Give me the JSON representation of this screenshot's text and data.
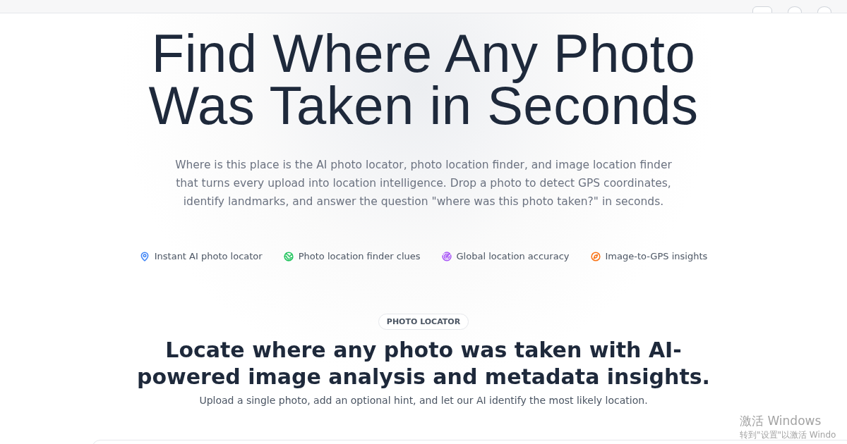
{
  "hero": {
    "title_lines": [
      "Find Where Any Photo",
      "Was Taken in Seconds"
    ],
    "description": "Where is this place is the AI photo locator, photo location finder, and image location finder that turns every upload into location intelligence. Drop a photo to detect GPS coordinates, identify landmarks, and answer the question \"where was this photo taken?\" in seconds.",
    "features": [
      {
        "kind": "pin",
        "label": "Instant AI photo locator",
        "color": "#3b82f6"
      },
      {
        "kind": "globe",
        "label": "Photo location finder clues",
        "color": "#22c55e"
      },
      {
        "kind": "radar",
        "label": "Global location accuracy",
        "color": "#a855f7"
      },
      {
        "kind": "compass",
        "label": "Image-to-GPS insights",
        "color": "#f97316"
      }
    ]
  },
  "locator": {
    "badge": "PHOTO LOCATOR",
    "heading": "Locate where any photo was taken with AI-powered image analysis and metadata insights.",
    "subtitle": "Upload a single photo, add an optional hint, and let our AI identify the most likely location."
  },
  "os_notice": {
    "title": "激活 Windows",
    "text": "转到\"设置\"以激活 Windo"
  }
}
